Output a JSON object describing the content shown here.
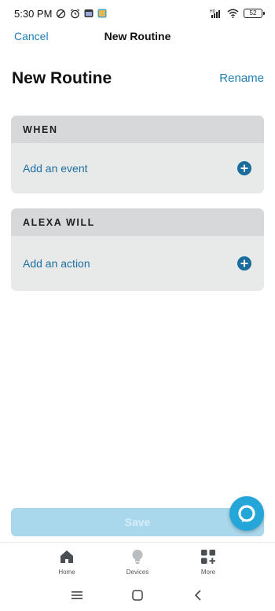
{
  "status_bar": {
    "time": "5:30 PM",
    "battery": "52",
    "network": "HD"
  },
  "header": {
    "cancel_label": "Cancel",
    "title": "New Routine"
  },
  "page": {
    "title": "New Routine",
    "rename_label": "Rename"
  },
  "when_card": {
    "header": "WHEN",
    "row_label": "Add an event"
  },
  "alexa_card": {
    "header": "ALEXA WILL",
    "row_label": "Add an action"
  },
  "save_label": "Save",
  "bottom_nav": {
    "items": [
      {
        "label": "Home",
        "icon": "home-icon"
      },
      {
        "label": "Devices",
        "icon": "lightbulb-icon"
      },
      {
        "label": "More",
        "icon": "grid-plus-icon"
      }
    ]
  },
  "colors": {
    "accent": "#1e7fb3",
    "card_bg": "#e8eaea",
    "card_header_bg": "#d7d8da",
    "save_disabled_bg": "#a9d7ec",
    "alexa_fab": "#25a6d9"
  }
}
